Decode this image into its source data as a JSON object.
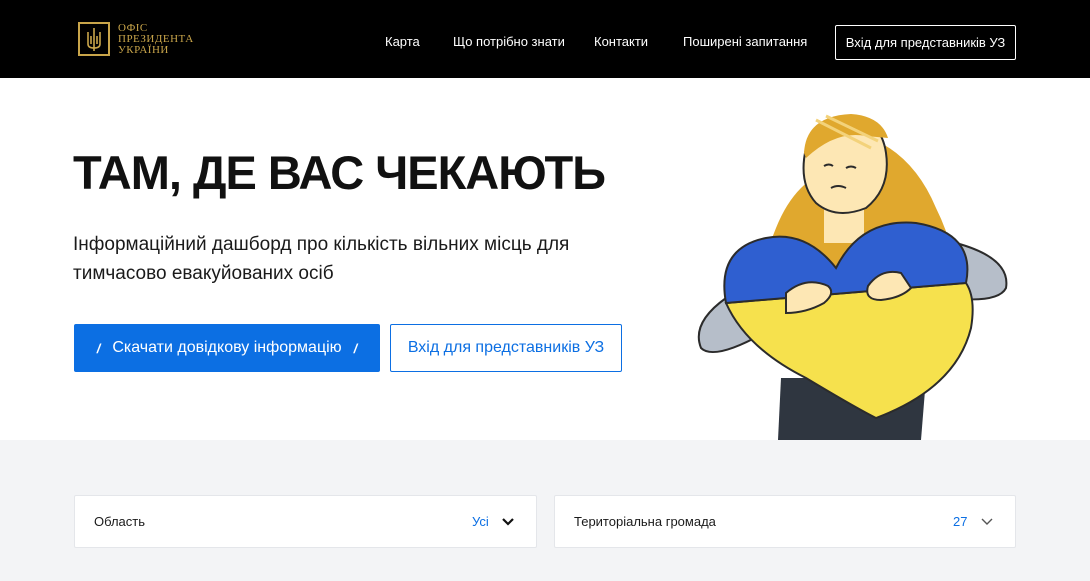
{
  "header": {
    "logo": {
      "line1": "ОФІС",
      "line2": "ПРЕЗИДЕНТА",
      "line3": "УКРАЇНИ",
      "color": "#c9a54a"
    },
    "nav": [
      {
        "label": "Карта"
      },
      {
        "label": "Що потрібно знати"
      },
      {
        "label": "Контакти"
      },
      {
        "label": "Поширені запитання"
      }
    ],
    "login_button": "Вхід для представників УЗ"
  },
  "hero": {
    "title": "ТАМ, ДЕ ВАС ЧЕКАЮТЬ",
    "subtitle": "Інформаційний дашборд про кількість вільних місць для тимчасово евакуйованих осіб",
    "download_button": "Скачати довідкову інформацію",
    "login_button": "Вхід для представників УЗ"
  },
  "filters": {
    "region": {
      "label": "Область",
      "value": "Усі",
      "icon": "chevron-down-icon"
    },
    "community": {
      "label": "Територіальна громада",
      "value": "27",
      "icon": "chevron-down-icon"
    }
  },
  "colors": {
    "accent": "#0c6fe3",
    "header_bg": "#000000",
    "section_bg": "#f3f4f6",
    "heart_blue": "#2f5fd0",
    "heart_yellow": "#f6e14d",
    "hair": "#e0a82e"
  }
}
